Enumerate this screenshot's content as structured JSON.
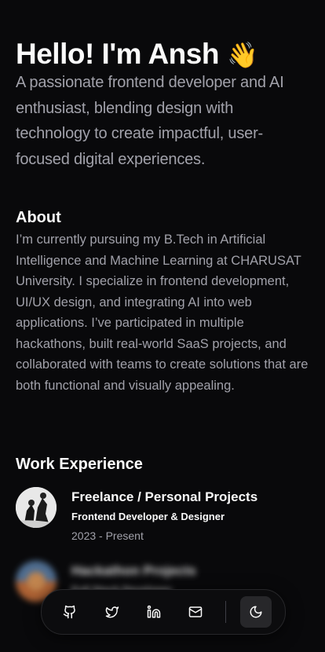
{
  "hero": {
    "title": "Hello! I'm Ansh",
    "wave": "👋",
    "subtitle": "A passionate frontend developer and AI enthusiast, blending design with technology to create impactful, user-focused digital experiences."
  },
  "about": {
    "title": "About",
    "text": "I’m currently pursuing my B.Tech in Artificial Intelligence and Machine Learning at CHARUSAT University. I specialize in frontend development, UI/UX design, and integrating AI into web applications. I’ve participated in multiple hackathons, built real-world SaaS projects, and collaborated with teams to create solutions that are both functional and visually appealing."
  },
  "work": {
    "title": "Work Experience",
    "items": [
      {
        "title": "Freelance / Personal Projects",
        "role": "Frontend Developer & Designer",
        "date": "2023 - Present"
      },
      {
        "title": "Hackathon Projects",
        "role": "Full Stack Developer",
        "date": ""
      }
    ]
  },
  "dock": {
    "icons": [
      "github-icon",
      "twitter-icon",
      "linkedin-icon",
      "mail-icon",
      "moon-icon"
    ]
  }
}
